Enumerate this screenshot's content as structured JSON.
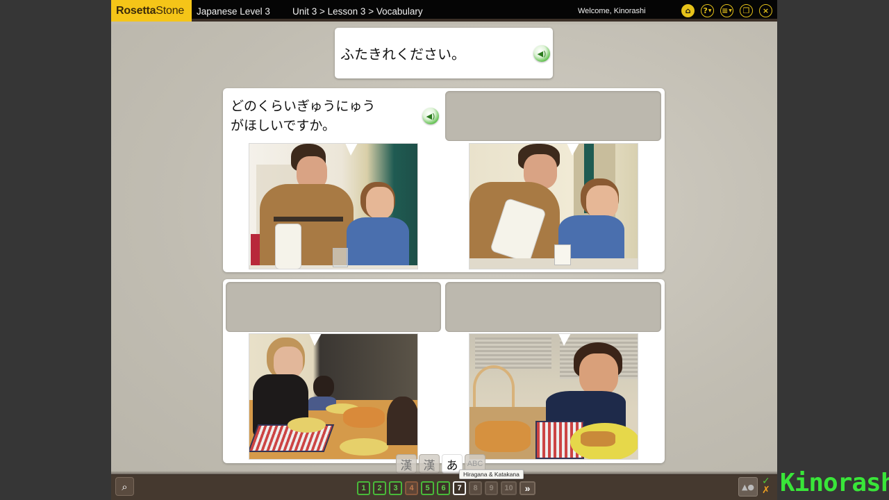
{
  "header": {
    "brand_bold": "Rosetta",
    "brand_light": "Stone",
    "course_title": "Japanese Level 3",
    "breadcrumb": "Unit 3 > Lesson 3 > Vocabulary",
    "welcome": "Welcome, Kinorashi",
    "icons": [
      {
        "name": "home-icon",
        "glyph": "⌂"
      },
      {
        "name": "help-icon",
        "glyph": "?"
      },
      {
        "name": "menu-list-icon",
        "glyph": "≡"
      },
      {
        "name": "window-mode-icon",
        "glyph": "❐"
      },
      {
        "name": "close-icon",
        "glyph": "×"
      }
    ]
  },
  "prompt": {
    "text": "ふたきれください。",
    "audio_icon": "speaker-icon"
  },
  "panels": [
    {
      "position": "top-left",
      "caption": "どのくらいぎゅうにゅうがほしいですか。",
      "caption_line1": "どのくらいぎゅうにゅう",
      "caption_line2": "がほしいですか。",
      "has_audio": true,
      "image": "man-with-milk-jug-and-boy"
    },
    {
      "position": "top-right",
      "caption": "",
      "image": "man-pouring-milk-boy-smiling"
    },
    {
      "position": "bottom-left",
      "caption": "",
      "image": "woman-serving-pizza-to-children"
    },
    {
      "position": "bottom-right",
      "caption": "",
      "image": "boy-taking-pizza-slice"
    }
  ],
  "script_toggle": {
    "options": [
      {
        "label": "漢",
        "name": "kanji-kana-option",
        "active": false
      },
      {
        "label": "漢",
        "name": "kanji-option",
        "active": false
      },
      {
        "label": "あ",
        "name": "hiragana-katakana-option",
        "active": true
      },
      {
        "label": "ABC",
        "name": "romaji-option",
        "active": false
      }
    ],
    "tooltip": "Hiragana & Katakana"
  },
  "pagination": {
    "pages": [
      {
        "label": "1",
        "state": "correct"
      },
      {
        "label": "2",
        "state": "correct"
      },
      {
        "label": "3",
        "state": "correct"
      },
      {
        "label": "4",
        "state": "wrong"
      },
      {
        "label": "5",
        "state": "correct"
      },
      {
        "label": "6",
        "state": "correct"
      },
      {
        "label": "7",
        "state": "current"
      },
      {
        "label": "8",
        "state": "todo"
      },
      {
        "label": "9",
        "state": "todo"
      },
      {
        "label": "10",
        "state": "todo"
      }
    ],
    "next_label": "»"
  },
  "footer": {
    "zoom_icon": "magnifier-icon",
    "shapes_icon": "shapes-icon",
    "correct_marker": "✓",
    "wrong_marker": "✗"
  },
  "watermark": "Kinorashi",
  "colors": {
    "brand_yellow": "#f5c518",
    "correct_green": "#49b93a",
    "wrong_orange": "#c07a4e",
    "watermark_green": "#39e639"
  }
}
